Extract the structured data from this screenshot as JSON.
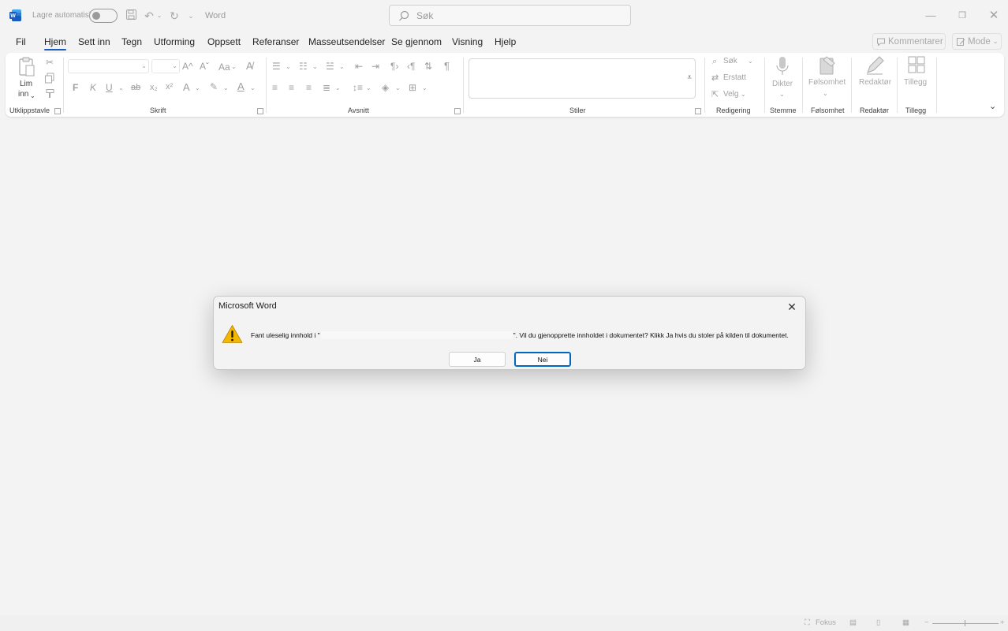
{
  "titlebar": {
    "autosave_label": "Lagre automatisk",
    "doc_title": "Word",
    "search_placeholder": "Søk"
  },
  "tabs": [
    "Fil",
    "Hjem",
    "Sett inn",
    "Tegn",
    "Utforming",
    "Oppsett",
    "Referanser",
    "Masseutsendelser",
    "Se gjennom",
    "Visning",
    "Hjelp"
  ],
  "active_tab": "Hjem",
  "top_right": {
    "comments": "Kommentarer",
    "mode": "Mode"
  },
  "ribbon": {
    "clipboard": {
      "paste_line1": "Lim",
      "paste_line2": "inn",
      "group": "Utklippstavle"
    },
    "font": {
      "group": "Skrift",
      "bold": "F",
      "italic": "K",
      "underline": "U",
      "strike": "ab",
      "subscript": "x₂",
      "superscript": "x²",
      "case": "Aa",
      "grow": "A^",
      "shrink": "Aˇ"
    },
    "paragraph": {
      "group": "Avsnitt"
    },
    "styles": {
      "group": "Stiler"
    },
    "editing": {
      "group": "Redigering",
      "find": "Søk",
      "replace": "Erstatt",
      "select": "Velg"
    },
    "voice": {
      "group": "Stemme",
      "dictate": "Dikter"
    },
    "sensitivity": {
      "group": "Følsomhet",
      "label": "Følsomhet"
    },
    "editor": {
      "group": "Redaktør",
      "label": "Redaktør"
    },
    "addins": {
      "group": "Tillegg",
      "label": "Tillegg"
    }
  },
  "dialog": {
    "title": "Microsoft Word",
    "message_before": "Fant uleselig innhold i \"",
    "message_after": "\". Vil du gjenopprette innholdet i dokumentet? Klikk Ja hvis du stoler på kilden til dokumentet.",
    "yes": "Ja",
    "no": "Nei"
  },
  "statusbar": {
    "focus": "Fokus"
  },
  "colors": {
    "accent": "#185abd",
    "word_blue": "#185abd",
    "warning_yellow": "#f4b700"
  }
}
